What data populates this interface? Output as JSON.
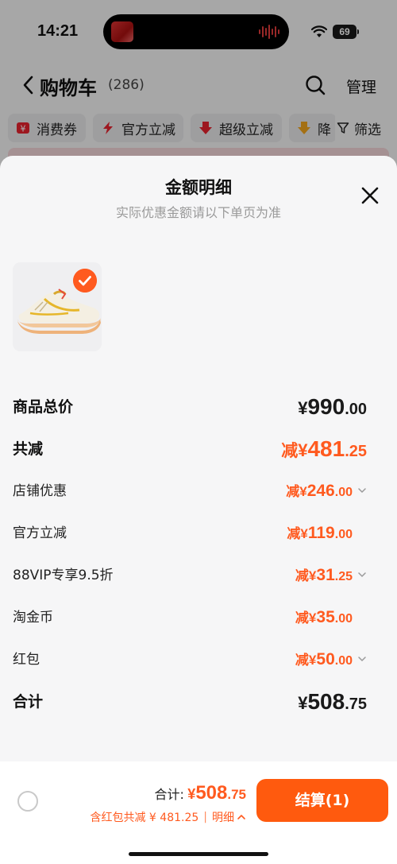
{
  "status_bar": {
    "time": "14:21",
    "battery": "69"
  },
  "nav": {
    "title": "购物车",
    "count": "(286)",
    "manage": "管理"
  },
  "filters": [
    "消费券",
    "官方立减",
    "超级立减",
    "降"
  ],
  "filter_button": "筛选",
  "sheet": {
    "title": "金额明细",
    "subtitle": "实际优惠金额请以下单页为准",
    "rows": [
      {
        "label": "商品总价",
        "prefix": "",
        "yen": "¥",
        "int": "990",
        "dec": ".00",
        "style": "big-black",
        "chevron": false
      },
      {
        "label": "共减",
        "prefix": "减",
        "yen": "¥",
        "int": "481",
        "dec": ".25",
        "style": "big-orange",
        "chevron": false
      },
      {
        "label": "店铺优惠",
        "prefix": "减",
        "yen": "¥",
        "int": "246",
        "dec": ".00",
        "style": "small-orange",
        "chevron": true
      },
      {
        "label": "官方立减",
        "prefix": "减",
        "yen": "¥",
        "int": "119",
        "dec": ".00",
        "style": "small-orange",
        "chevron": false
      },
      {
        "label": "88VIP专享9.5折",
        "prefix": "减",
        "yen": "¥",
        "int": "31",
        "dec": ".25",
        "style": "small-orange",
        "chevron": true
      },
      {
        "label": "淘金币",
        "prefix": "减",
        "yen": "¥",
        "int": "35",
        "dec": ".00",
        "style": "small-orange",
        "chevron": false
      },
      {
        "label": "红包",
        "prefix": "减",
        "yen": "¥",
        "int": "50",
        "dec": ".00",
        "style": "small-orange",
        "chevron": true
      },
      {
        "label": "合计",
        "prefix": "",
        "yen": "¥",
        "int": "508",
        "dec": ".75",
        "style": "big-black",
        "chevron": false
      }
    ]
  },
  "bottom_bar": {
    "total_label": "合计:",
    "total_yen": "¥",
    "total_int": "508",
    "total_dec": ".75",
    "discount_text": "含红包共减 ¥ 481.25",
    "separator": "|",
    "detail_label": "明细",
    "checkout_label": "结算(1)"
  },
  "colors": {
    "accent": "#ff5a1f",
    "checkout": "#ff5a0e",
    "sheet_bg": "#f6f6f7"
  }
}
